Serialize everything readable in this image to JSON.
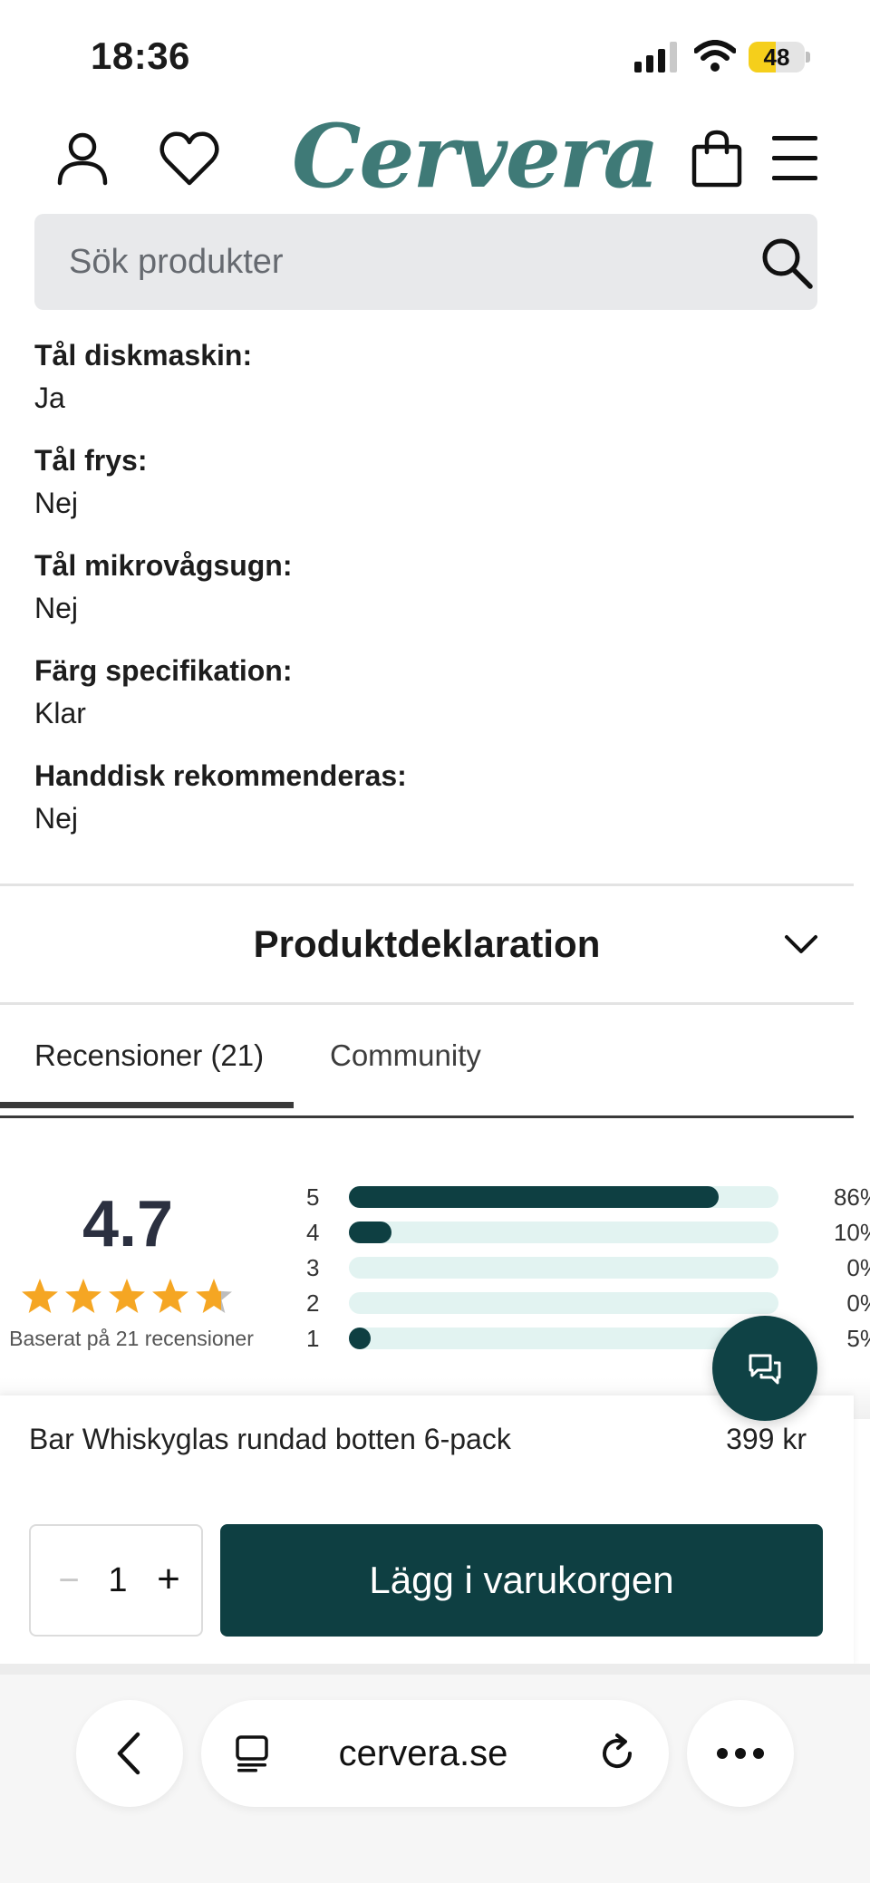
{
  "status_bar": {
    "time": "18:36",
    "battery": "48",
    "battery_level": 0.48
  },
  "header": {
    "logo": "Cervera"
  },
  "search": {
    "placeholder": "Sök produkter"
  },
  "specs": [
    {
      "label": "Tål diskmaskin:",
      "value": "Ja"
    },
    {
      "label": "Tål frys:",
      "value": "Nej"
    },
    {
      "label": "Tål mikrovågsugn:",
      "value": "Nej"
    },
    {
      "label": "Färg specifikation:",
      "value": "Klar"
    },
    {
      "label": "Handdisk rekommenderas:",
      "value": "Nej"
    }
  ],
  "accordion": {
    "title": "Produktdeklaration"
  },
  "tabs": [
    {
      "label": "Recensioner (21)",
      "active": true
    },
    {
      "label": "Community",
      "active": false
    }
  ],
  "reviews": {
    "average": "4.7",
    "stars": 4.7,
    "basis": "Baserat på 21 recensioner",
    "distribution": [
      {
        "stars": "5",
        "percent": "86%",
        "value": 86
      },
      {
        "stars": "4",
        "percent": "10%",
        "value": 10
      },
      {
        "stars": "3",
        "percent": "0%",
        "value": 0
      },
      {
        "stars": "2",
        "percent": "0%",
        "value": 0
      },
      {
        "stars": "1",
        "percent": "5%",
        "value": 5
      }
    ]
  },
  "cart_bar": {
    "product_name": "Bar Whiskyglas rundad botten 6-pack",
    "price": "399 kr",
    "minus": "−",
    "quantity": "1",
    "plus": "+",
    "add_button": "Lägg i varukorgen"
  },
  "browser": {
    "url": "cervera.se"
  },
  "colors": {
    "accent": "#0e3f42",
    "logo": "#3f7a77",
    "star": "#f5a623",
    "bar_track": "#e2f3f1"
  }
}
